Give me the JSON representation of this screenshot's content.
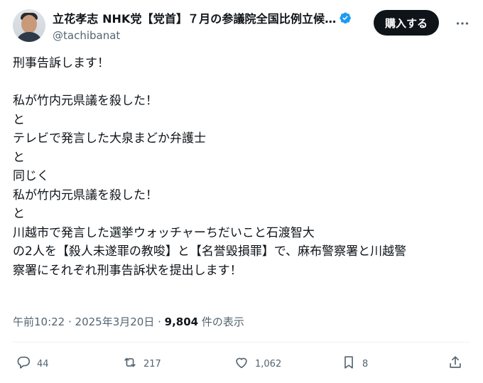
{
  "user": {
    "display_name": "立花孝志 NHK党【党首】７月の参議院全国比例立候…",
    "handle": "@tachibanat"
  },
  "header": {
    "buy_label": "購入する"
  },
  "icons": {
    "verified": "verified-badge-icon",
    "more": "more-horizontal-icon",
    "reply": "reply-icon",
    "retweet": "retweet-icon",
    "like": "heart-icon",
    "bookmark": "bookmark-icon",
    "share": "share-icon"
  },
  "colors": {
    "verified": "#1d9bf0",
    "text": "#0f1419",
    "muted": "#536471",
    "button": "#0f1419"
  },
  "tweet": {
    "lines": [
      "刑事告訴します！",
      "",
      "私が竹内元県議を殺した！",
      "と",
      "テレビで発言した大泉まどか弁護士",
      "と",
      "同じく",
      "私が竹内元県議を殺した！",
      "と",
      "川越市で発言した選挙ウォッチャーちだいこと石渡智大",
      "の2人を【殺人未遂罪の教唆】と【名誉毀損罪】で、麻布警察署と川越警",
      "察署にそれぞれ刑事告訴状を提出します！"
    ]
  },
  "meta": {
    "time": "午前10:22",
    "separator1": " · ",
    "date": "2025年3月20日",
    "separator2": " · ",
    "views": "9,804",
    "views_label": " 件の表示"
  },
  "actions": {
    "replies": "44",
    "retweets": "217",
    "likes": "1,062",
    "bookmarks": "8"
  }
}
